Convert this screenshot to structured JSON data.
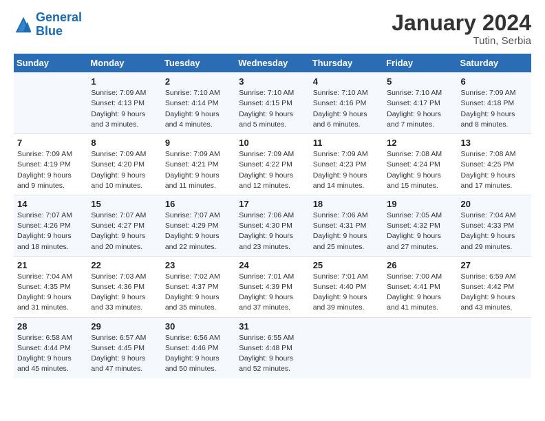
{
  "header": {
    "logo_text_general": "General",
    "logo_text_blue": "Blue",
    "month_title": "January 2024",
    "location": "Tutin, Serbia"
  },
  "weekdays": [
    "Sunday",
    "Monday",
    "Tuesday",
    "Wednesday",
    "Thursday",
    "Friday",
    "Saturday"
  ],
  "weeks": [
    [
      {
        "day": "",
        "info": ""
      },
      {
        "day": "1",
        "info": "Sunrise: 7:09 AM\nSunset: 4:13 PM\nDaylight: 9 hours\nand 3 minutes."
      },
      {
        "day": "2",
        "info": "Sunrise: 7:10 AM\nSunset: 4:14 PM\nDaylight: 9 hours\nand 4 minutes."
      },
      {
        "day": "3",
        "info": "Sunrise: 7:10 AM\nSunset: 4:15 PM\nDaylight: 9 hours\nand 5 minutes."
      },
      {
        "day": "4",
        "info": "Sunrise: 7:10 AM\nSunset: 4:16 PM\nDaylight: 9 hours\nand 6 minutes."
      },
      {
        "day": "5",
        "info": "Sunrise: 7:10 AM\nSunset: 4:17 PM\nDaylight: 9 hours\nand 7 minutes."
      },
      {
        "day": "6",
        "info": "Sunrise: 7:09 AM\nSunset: 4:18 PM\nDaylight: 9 hours\nand 8 minutes."
      }
    ],
    [
      {
        "day": "7",
        "info": "Sunrise: 7:09 AM\nSunset: 4:19 PM\nDaylight: 9 hours\nand 9 minutes."
      },
      {
        "day": "8",
        "info": "Sunrise: 7:09 AM\nSunset: 4:20 PM\nDaylight: 9 hours\nand 10 minutes."
      },
      {
        "day": "9",
        "info": "Sunrise: 7:09 AM\nSunset: 4:21 PM\nDaylight: 9 hours\nand 11 minutes."
      },
      {
        "day": "10",
        "info": "Sunrise: 7:09 AM\nSunset: 4:22 PM\nDaylight: 9 hours\nand 12 minutes."
      },
      {
        "day": "11",
        "info": "Sunrise: 7:09 AM\nSunset: 4:23 PM\nDaylight: 9 hours\nand 14 minutes."
      },
      {
        "day": "12",
        "info": "Sunrise: 7:08 AM\nSunset: 4:24 PM\nDaylight: 9 hours\nand 15 minutes."
      },
      {
        "day": "13",
        "info": "Sunrise: 7:08 AM\nSunset: 4:25 PM\nDaylight: 9 hours\nand 17 minutes."
      }
    ],
    [
      {
        "day": "14",
        "info": "Sunrise: 7:07 AM\nSunset: 4:26 PM\nDaylight: 9 hours\nand 18 minutes."
      },
      {
        "day": "15",
        "info": "Sunrise: 7:07 AM\nSunset: 4:27 PM\nDaylight: 9 hours\nand 20 minutes."
      },
      {
        "day": "16",
        "info": "Sunrise: 7:07 AM\nSunset: 4:29 PM\nDaylight: 9 hours\nand 22 minutes."
      },
      {
        "day": "17",
        "info": "Sunrise: 7:06 AM\nSunset: 4:30 PM\nDaylight: 9 hours\nand 23 minutes."
      },
      {
        "day": "18",
        "info": "Sunrise: 7:06 AM\nSunset: 4:31 PM\nDaylight: 9 hours\nand 25 minutes."
      },
      {
        "day": "19",
        "info": "Sunrise: 7:05 AM\nSunset: 4:32 PM\nDaylight: 9 hours\nand 27 minutes."
      },
      {
        "day": "20",
        "info": "Sunrise: 7:04 AM\nSunset: 4:33 PM\nDaylight: 9 hours\nand 29 minutes."
      }
    ],
    [
      {
        "day": "21",
        "info": "Sunrise: 7:04 AM\nSunset: 4:35 PM\nDaylight: 9 hours\nand 31 minutes."
      },
      {
        "day": "22",
        "info": "Sunrise: 7:03 AM\nSunset: 4:36 PM\nDaylight: 9 hours\nand 33 minutes."
      },
      {
        "day": "23",
        "info": "Sunrise: 7:02 AM\nSunset: 4:37 PM\nDaylight: 9 hours\nand 35 minutes."
      },
      {
        "day": "24",
        "info": "Sunrise: 7:01 AM\nSunset: 4:39 PM\nDaylight: 9 hours\nand 37 minutes."
      },
      {
        "day": "25",
        "info": "Sunrise: 7:01 AM\nSunset: 4:40 PM\nDaylight: 9 hours\nand 39 minutes."
      },
      {
        "day": "26",
        "info": "Sunrise: 7:00 AM\nSunset: 4:41 PM\nDaylight: 9 hours\nand 41 minutes."
      },
      {
        "day": "27",
        "info": "Sunrise: 6:59 AM\nSunset: 4:42 PM\nDaylight: 9 hours\nand 43 minutes."
      }
    ],
    [
      {
        "day": "28",
        "info": "Sunrise: 6:58 AM\nSunset: 4:44 PM\nDaylight: 9 hours\nand 45 minutes."
      },
      {
        "day": "29",
        "info": "Sunrise: 6:57 AM\nSunset: 4:45 PM\nDaylight: 9 hours\nand 47 minutes."
      },
      {
        "day": "30",
        "info": "Sunrise: 6:56 AM\nSunset: 4:46 PM\nDaylight: 9 hours\nand 50 minutes."
      },
      {
        "day": "31",
        "info": "Sunrise: 6:55 AM\nSunset: 4:48 PM\nDaylight: 9 hours\nand 52 minutes."
      },
      {
        "day": "",
        "info": ""
      },
      {
        "day": "",
        "info": ""
      },
      {
        "day": "",
        "info": ""
      }
    ]
  ]
}
